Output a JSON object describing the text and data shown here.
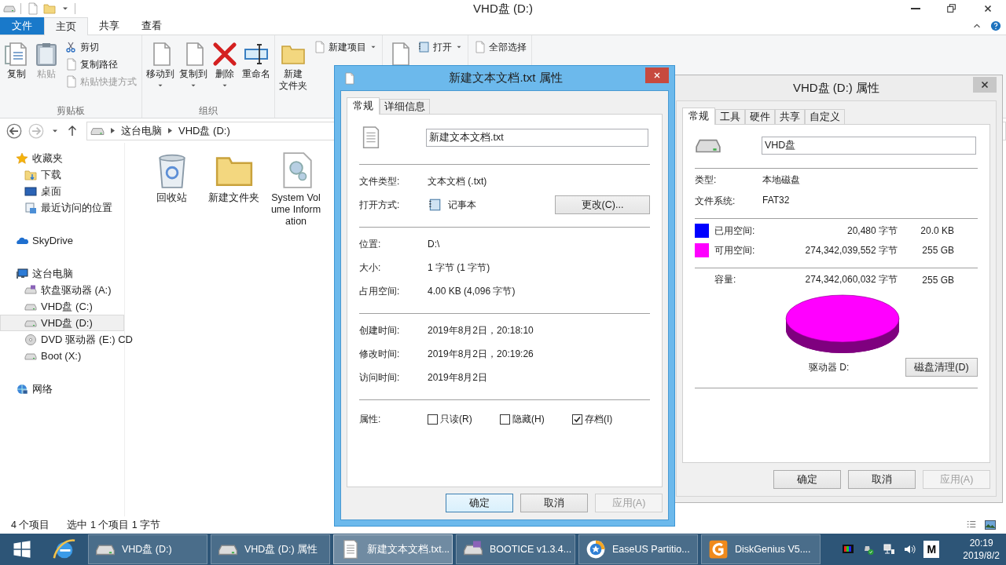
{
  "explorer": {
    "title": "VHD盘 (D:)",
    "ribbon_tabs": [
      {
        "label": "文件",
        "kind": "file",
        "selected": false
      },
      {
        "label": "主页",
        "kind": "tab",
        "selected": true
      },
      {
        "label": "共享",
        "kind": "tab",
        "selected": false
      },
      {
        "label": "查看",
        "kind": "tab",
        "selected": false
      }
    ],
    "ribbon_groups": [
      {
        "label": "剪贴板",
        "buttons": [
          {
            "label": "复制",
            "kind": "large",
            "disabled": false,
            "dropdown": false
          },
          {
            "label": "粘贴",
            "kind": "large",
            "disabled": true,
            "dropdown": false
          },
          {
            "label": "剪切",
            "kind": "small",
            "disabled": false,
            "dropdown": false
          },
          {
            "label": "复制路径",
            "kind": "small",
            "disabled": false,
            "dropdown": false
          },
          {
            "label": "粘贴快捷方式",
            "kind": "small",
            "disabled": true,
            "dropdown": false
          }
        ]
      },
      {
        "label": "组织",
        "buttons": [
          {
            "label": "移动到",
            "kind": "large",
            "disabled": false,
            "dropdown": true
          },
          {
            "label": "复制到",
            "kind": "large",
            "disabled": false,
            "dropdown": true
          },
          {
            "label": "删除",
            "kind": "large",
            "disabled": false,
            "dropdown": true
          },
          {
            "label": "重命名",
            "kind": "large",
            "disabled": false,
            "dropdown": false
          }
        ]
      },
      {
        "buttons": [
          {
            "lines": [
              "新建",
              "文件夹"
            ],
            "kind": "large",
            "disabled": false,
            "dropdown": false
          },
          {
            "label": "新建项目",
            "kind": "small",
            "disabled": false,
            "dropdown": true
          }
        ]
      },
      {
        "buttons": [
          {
            "kind": "large"
          },
          {
            "label": "打开",
            "kind": "small",
            "disabled": false,
            "dropdown": true
          }
        ]
      },
      {
        "buttons": [
          {
            "label": "全部选择",
            "kind": "small",
            "disabled": false,
            "dropdown": false
          }
        ]
      }
    ],
    "crumbs": [
      "这台电脑",
      "VHD盘 (D:)"
    ],
    "nav": [
      {
        "label": "收藏夹",
        "kind": "favorites",
        "selected": false,
        "children": [
          {
            "label": "下载",
            "kind": "downloads",
            "selected": false
          },
          {
            "label": "桌面",
            "kind": "desktop",
            "selected": false
          },
          {
            "label": "最近访问的位置",
            "kind": "recent",
            "selected": false
          }
        ]
      },
      {
        "label": "SkyDrive",
        "kind": "cloud",
        "selected": false
      },
      {
        "label": "这台电脑",
        "kind": "computer",
        "selected": false,
        "children": [
          {
            "label": "软盘驱动器 (A:)",
            "kind": "floppy",
            "selected": false
          },
          {
            "label": "VHD盘 (C:)",
            "kind": "drive",
            "selected": false
          },
          {
            "label": "VHD盘 (D:)",
            "kind": "drive",
            "selected": true
          },
          {
            "label": "DVD 驱动器 (E:) CD",
            "kind": "dvd",
            "selected": false
          },
          {
            "label": "Boot (X:)",
            "kind": "drive",
            "selected": false
          }
        ]
      },
      {
        "label": "网络",
        "kind": "network",
        "selected": false
      }
    ],
    "files": [
      {
        "name": "回收站",
        "kind": "recycle"
      },
      {
        "name": "新建文件夹",
        "kind": "folder"
      },
      {
        "name": "System Volume Information",
        "kind": "system"
      }
    ],
    "status": {
      "items": "4 个项目",
      "selection": "选中 1 个项目 1 字节"
    }
  },
  "file_dialog": {
    "title": "新建文本文档.txt 属性",
    "tabs": [
      {
        "label": "常规",
        "selected": true
      },
      {
        "label": "详细信息",
        "selected": false
      }
    ],
    "name": "新建文本文档.txt",
    "sections": [
      [
        {
          "label": "文件类型:",
          "value": "文本文档 (.txt)"
        },
        {
          "label": "打开方式:",
          "value": "记事本",
          "button": "更改(C)..."
        }
      ],
      [
        {
          "label": "位置:",
          "value": "D:\\"
        },
        {
          "label": "大小:",
          "value": "1 字节 (1 字节)"
        },
        {
          "label": "占用空间:",
          "value": "4.00 KB (4,096 字节)"
        }
      ],
      [
        {
          "label": "创建时间:",
          "value": "2019年8月2日，20:18:10"
        },
        {
          "label": "修改时间:",
          "value": "2019年8月2日，20:19:26"
        },
        {
          "label": "访问时间:",
          "value": "2019年8月2日"
        }
      ]
    ],
    "attributes_label": "属性:",
    "attributes": [
      {
        "label": "只读(R)",
        "checked": false
      },
      {
        "label": "隐藏(H)",
        "checked": false
      },
      {
        "label": "存档(I)",
        "checked": true
      }
    ],
    "buttons": [
      {
        "label": "确定",
        "default": true,
        "disabled": false
      },
      {
        "label": "取消",
        "default": false,
        "disabled": false
      },
      {
        "label": "应用(A)",
        "default": false,
        "disabled": true
      }
    ]
  },
  "drive_dialog": {
    "title": "VHD盘 (D:) 属性",
    "tabs": [
      {
        "label": "常规",
        "selected": true
      },
      {
        "label": "工具",
        "selected": false
      },
      {
        "label": "硬件",
        "selected": false
      },
      {
        "label": "共享",
        "selected": false
      },
      {
        "label": "自定义",
        "selected": false
      }
    ],
    "name": "VHD盘",
    "info": [
      {
        "label": "类型:",
        "value": "本地磁盘"
      },
      {
        "label": "文件系统:",
        "value": "FAT32"
      }
    ],
    "space": [
      {
        "label": "已用空间:",
        "bytes": "20,480 字节",
        "size": "20.0 KB",
        "color": "#0000ff"
      },
      {
        "label": "可用空间:",
        "bytes": "274,342,039,552 字节",
        "size": "255 GB",
        "color": "#ff00ff"
      }
    ],
    "capacity": {
      "label": "容量:",
      "bytes": "274,342,060,032 字节",
      "size": "255 GB"
    },
    "drive_label": "驱动器 D:",
    "cleanup_button": "磁盘清理(D)",
    "buttons": [
      {
        "label": "确定",
        "default": false,
        "disabled": false
      },
      {
        "label": "取消",
        "default": false,
        "disabled": false
      },
      {
        "label": "应用(A)",
        "default": false,
        "disabled": true
      }
    ]
  },
  "taskbar": {
    "tasks": [
      {
        "label": "VHD盘 (D:)",
        "kind": "drive",
        "selected": false
      },
      {
        "label": "VHD盘 (D:) 属性",
        "kind": "drive",
        "selected": false
      },
      {
        "label": "新建文本文档.txt...",
        "kind": "doc",
        "selected": true
      },
      {
        "label": "BOOTICE v1.3.4...",
        "kind": "floppy",
        "selected": false
      },
      {
        "label": "EaseUS Partitio...",
        "kind": "easeus",
        "selected": false
      },
      {
        "label": "DiskGenius V5....",
        "kind": "diskgenius",
        "selected": false
      }
    ],
    "ime": "M",
    "time": "20:19",
    "date": "2019/8/2"
  }
}
